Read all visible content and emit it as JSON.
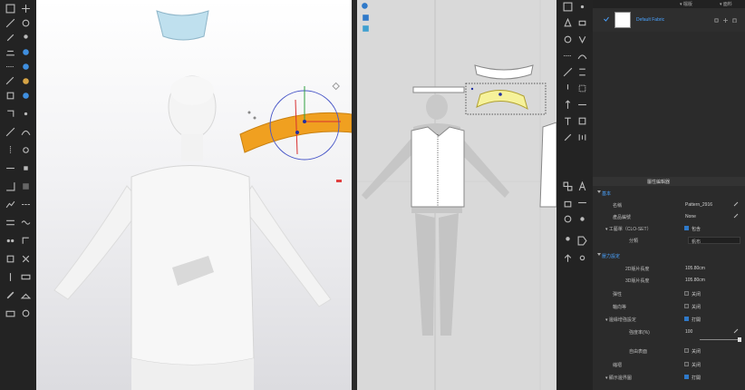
{
  "panel": {
    "tabs": [
      "▾ 檔版",
      "▾ 面料"
    ],
    "fabric": {
      "name": "Default Fabric"
    },
    "properties_title": "屬性編輯器",
    "sections": {
      "basic": "基本",
      "pressure": "壓力設定"
    },
    "rows": {
      "name": {
        "label": "名稱",
        "value": "Pattern_2916"
      },
      "product_code": {
        "label": "產品編號",
        "value": "None"
      },
      "craft_sheet": {
        "label": "▾ 工藝單（CLO-SET）",
        "value": "包含"
      },
      "category": {
        "label": "分類",
        "value": "帆布"
      },
      "length_2d": {
        "label": "2D版片長度",
        "value": "105.80cm"
      },
      "length_3d": {
        "label": "3D版片長度",
        "value": "105.80cm"
      },
      "elastic": {
        "label": "彈性",
        "value": "关闭"
      },
      "fold": {
        "label": "軸向等",
        "value": "关闭"
      },
      "edge_strength": {
        "label": "▾ 邊緣增強設定",
        "value": "打開"
      },
      "strength_pct": {
        "label": "強度率(%)",
        "value": "100"
      },
      "free_surface": {
        "label": "自由表面",
        "value": "关闭"
      },
      "pleat": {
        "label": "縮褶",
        "value": "关闭"
      },
      "display_outline": {
        "label": "▾ 顯示邊界圖",
        "value": "打開"
      }
    }
  },
  "colors": {
    "accent": "#4aa3ff",
    "selected_pattern": "#f0a020",
    "toolbar_bg": "#232323",
    "panel_bg": "#2b2b2b"
  }
}
